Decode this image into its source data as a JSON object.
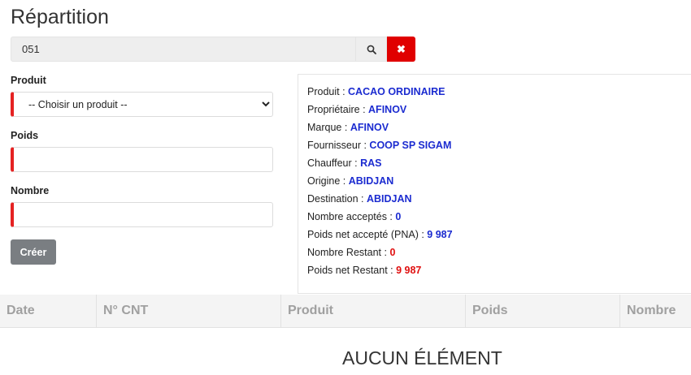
{
  "page": {
    "title": "Répartition"
  },
  "search": {
    "value": "051"
  },
  "form": {
    "produit": {
      "label": "Produit",
      "selected": "-- Choisir un produit --"
    },
    "poids": {
      "label": "Poids",
      "value": ""
    },
    "nombre": {
      "label": "Nombre",
      "value": ""
    },
    "create_label": "Créer"
  },
  "info": [
    {
      "label": "Produit : ",
      "value": "CACAO ORDINAIRE",
      "color": "#1b2bd0"
    },
    {
      "label": "Propriétaire : ",
      "value": "AFINOV",
      "color": "#1b2bd0"
    },
    {
      "label": "Marque : ",
      "value": "AFINOV",
      "color": "#1b2bd0"
    },
    {
      "label": "Fournisseur : ",
      "value": "COOP SP SIGAM",
      "color": "#1b2bd0"
    },
    {
      "label": "Chauffeur : ",
      "value": "RAS",
      "color": "#1b2bd0"
    },
    {
      "label": "Origine : ",
      "value": "ABIDJAN",
      "color": "#1b2bd0"
    },
    {
      "label": "Destination : ",
      "value": "ABIDJAN",
      "color": "#1b2bd0"
    },
    {
      "label": "Nombre acceptés : ",
      "value": "0",
      "color": "#1b2bd0"
    },
    {
      "label": "Poids net accepté (PNA) : ",
      "value": "9 987",
      "color": "#1b2bd0"
    },
    {
      "label": "Nombre Restant : ",
      "value": "0",
      "color": "#e01010"
    },
    {
      "label": "Poids net Restant : ",
      "value": "9 987",
      "color": "#e01010"
    }
  ],
  "table": {
    "columns": [
      "Date",
      "N° CNT",
      "Produit",
      "Poids",
      "Nombre"
    ],
    "empty_text": "AUCUN ÉLÉMENT"
  },
  "icons": {
    "search": "search-icon",
    "clear": "close-icon"
  }
}
